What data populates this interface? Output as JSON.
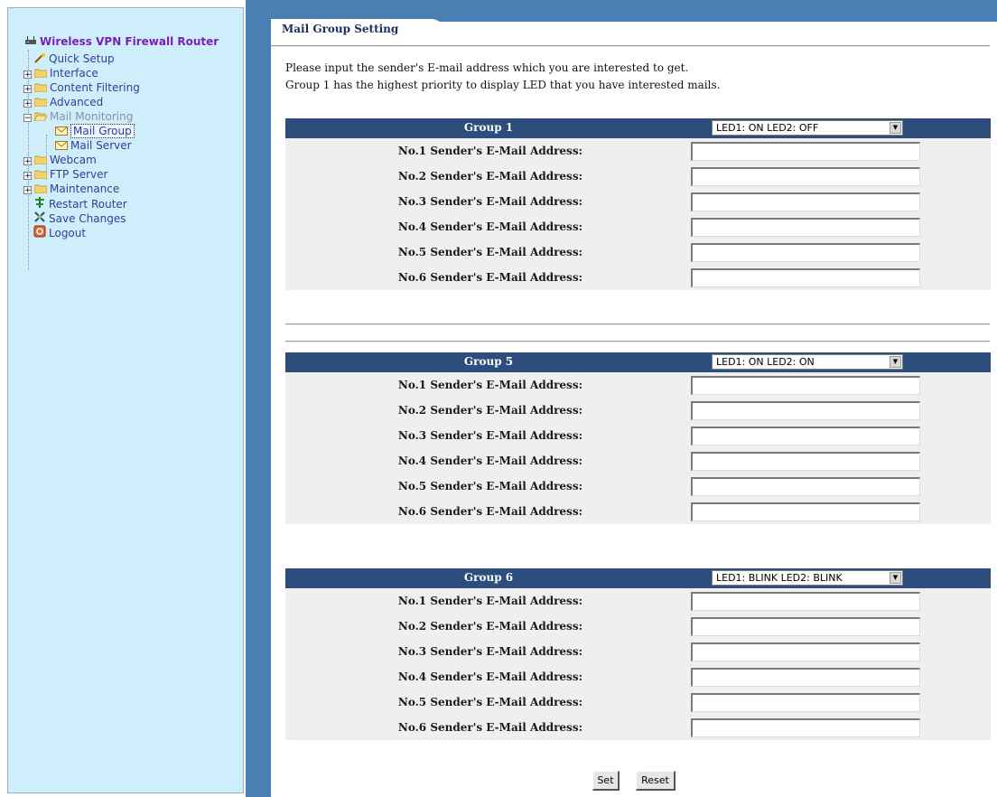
{
  "sidebar": {
    "root_title": "Wireless VPN Firewall Router",
    "items": [
      {
        "label": "Quick Setup"
      },
      {
        "label": "Interface"
      },
      {
        "label": "Content Filtering"
      },
      {
        "label": "Advanced"
      },
      {
        "label": "Mail Monitoring"
      },
      {
        "label": "Mail Group"
      },
      {
        "label": "Mail Server"
      },
      {
        "label": "Webcam"
      },
      {
        "label": "FTP Server"
      },
      {
        "label": "Maintenance"
      },
      {
        "label": "Restart Router"
      },
      {
        "label": "Save Changes"
      },
      {
        "label": "Logout"
      }
    ]
  },
  "tab": {
    "title": "Mail Group Setting"
  },
  "intro": {
    "line1": "Please input the sender's E-mail address which you are interested to get.",
    "line2": "Group 1 has the highest priority to display LED that you have interested mails."
  },
  "groups": [
    {
      "title": "Group 1",
      "led_select": "LED1: ON   LED2: OFF",
      "rows": [
        {
          "label": "No.1 Sender's E-Mail Address:",
          "value": ""
        },
        {
          "label": "No.2 Sender's E-Mail Address:",
          "value": ""
        },
        {
          "label": "No.3 Sender's E-Mail Address:",
          "value": ""
        },
        {
          "label": "No.4 Sender's E-Mail Address:",
          "value": ""
        },
        {
          "label": "No.5 Sender's E-Mail Address:",
          "value": ""
        },
        {
          "label": "No.6 Sender's E-Mail Address:",
          "value": ""
        }
      ]
    },
    {
      "title": "Group 5",
      "led_select": "LED1: ON   LED2: ON",
      "rows": [
        {
          "label": "No.1 Sender's E-Mail Address:",
          "value": ""
        },
        {
          "label": "No.2 Sender's E-Mail Address:",
          "value": ""
        },
        {
          "label": "No.3 Sender's E-Mail Address:",
          "value": ""
        },
        {
          "label": "No.4 Sender's E-Mail Address:",
          "value": ""
        },
        {
          "label": "No.5 Sender's E-Mail Address:",
          "value": ""
        },
        {
          "label": "No.6 Sender's E-Mail Address:",
          "value": ""
        }
      ]
    },
    {
      "title": "Group 6",
      "led_select": "LED1: BLINK LED2: BLINK",
      "rows": [
        {
          "label": "No.1 Sender's E-Mail Address:",
          "value": ""
        },
        {
          "label": "No.2 Sender's E-Mail Address:",
          "value": ""
        },
        {
          "label": "No.3 Sender's E-Mail Address:",
          "value": ""
        },
        {
          "label": "No.4 Sender's E-Mail Address:",
          "value": ""
        },
        {
          "label": "No.5 Sender's E-Mail Address:",
          "value": ""
        },
        {
          "label": "No.6 Sender's E-Mail Address:",
          "value": ""
        }
      ]
    }
  ],
  "buttons": {
    "set": "Set",
    "reset": "Reset"
  },
  "colors": {
    "sidebar_bg": "#cfeefb",
    "frame_blue": "#4a7fb4",
    "group_header": "#2d4d7c",
    "row_bg": "#efefef",
    "root_title": "#7a1fb8",
    "tree_link": "#2e3f99"
  },
  "icons": {
    "root": "router-icon",
    "quick_setup": "wand-icon",
    "folders": "folder-icon",
    "mail": "mail-envelope-icon",
    "restart": "restart-icon",
    "save": "save-icon",
    "logout": "logout-icon"
  }
}
